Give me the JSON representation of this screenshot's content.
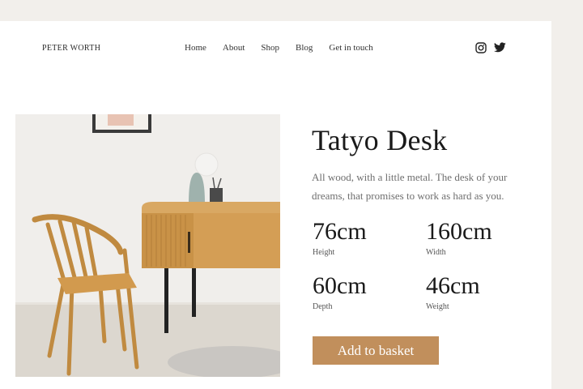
{
  "brand": "PETER WORTH",
  "nav": [
    "Home",
    "About",
    "Shop",
    "Blog",
    "Get in touch"
  ],
  "social": [
    "instagram-icon",
    "twitter-icon"
  ],
  "product": {
    "title": "Tatyo Desk",
    "description": "All wood, with a little metal. The desk of your dreams, that promises to work as hard as you.",
    "specs": [
      {
        "value": "76cm",
        "label": "Height"
      },
      {
        "value": "160cm",
        "label": "Width"
      },
      {
        "value": "60cm",
        "label": "Depth"
      },
      {
        "value": "46cm",
        "label": "Weight"
      }
    ],
    "cta": "Add to basket"
  },
  "colors": {
    "background": "#f2efeb",
    "card": "#ffffff",
    "accent": "#c18f5c",
    "text": "#1a1a1a",
    "muted": "#6e6e6e"
  }
}
